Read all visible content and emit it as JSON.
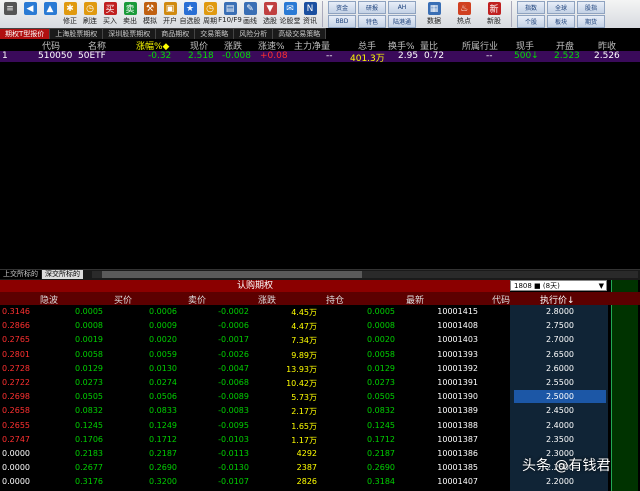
{
  "toolbar": {
    "buttons": [
      {
        "label": "",
        "icon": "menu-icon"
      },
      {
        "label": "",
        "icon": "back-arrow-icon"
      },
      {
        "label": "",
        "icon": "up-arrow-icon"
      },
      {
        "label": "修正",
        "icon": "gear-icon"
      },
      {
        "label": "刷连",
        "icon": "clock-icon"
      },
      {
        "label": "买入",
        "icon": "buy-icon"
      },
      {
        "label": "卖出",
        "icon": "sell-icon"
      },
      {
        "label": "模拟",
        "icon": "hammer-icon"
      },
      {
        "label": "开户",
        "icon": "lock-icon"
      },
      {
        "label": "自选股",
        "icon": "star-icon"
      },
      {
        "label": "周期",
        "icon": "clock-icon"
      },
      {
        "label": "F10/F9",
        "icon": "document-icon"
      },
      {
        "label": "画线",
        "icon": "pen-icon"
      },
      {
        "label": "选股",
        "icon": "filter-icon"
      },
      {
        "label": "论股堂",
        "icon": "chat-icon"
      },
      {
        "label": "资讯",
        "icon": "news-icon"
      }
    ],
    "grid1": [
      "资金",
      "研报",
      "AH",
      "BBD",
      "特色",
      "陆港通"
    ],
    "grid2_labels": [
      "数据",
      "热点",
      "新股"
    ],
    "grid3": [
      "指数",
      "全球",
      "股指",
      "个股",
      "板块",
      "期货"
    ]
  },
  "tabs": [
    "期权T型报价",
    "上海股票期权",
    "深圳股票期权",
    "商品期权",
    "交易策略",
    "风险分析",
    "高级交易策略"
  ],
  "header": [
    "代码",
    "名称",
    "涨幅%◆",
    "现价",
    "涨跌",
    "涨速%",
    "主力净量",
    "总手",
    "换手%",
    "量比",
    "所属行业",
    "现手",
    "开盘",
    "昨收"
  ],
  "quote_row": [
    "1",
    "510050",
    "50ETF",
    "-0.32",
    "2.518",
    "-0.008",
    "+0.08",
    "--",
    "401.3万",
    "2.95",
    "0.72",
    "--",
    "500↓",
    "2.523",
    "2.526"
  ],
  "sub_tabs": [
    "上交所标的",
    "深交所标的"
  ],
  "option_title": "认购期权",
  "expiry_select": "1808 ■ (8天)",
  "option_header": [
    "隐波",
    "买价",
    "卖价",
    "涨跌",
    "持仓",
    "最新",
    "代码",
    "执行价↓"
  ],
  "options": [
    [
      "0.3146",
      "0.0005",
      "0.0006",
      "-0.0002",
      "4.45万",
      "0.0005",
      "10001415",
      "2.8000"
    ],
    [
      "0.2866",
      "0.0008",
      "0.0009",
      "-0.0006",
      "4.47万",
      "0.0008",
      "10001408",
      "2.7500"
    ],
    [
      "0.2765",
      "0.0019",
      "0.0020",
      "-0.0017",
      "7.34万",
      "0.0020",
      "10001403",
      "2.7000"
    ],
    [
      "0.2801",
      "0.0058",
      "0.0059",
      "-0.0026",
      "9.89万",
      "0.0058",
      "10001393",
      "2.6500"
    ],
    [
      "0.2728",
      "0.0129",
      "0.0130",
      "-0.0047",
      "13.93万",
      "0.0129",
      "10001392",
      "2.6000"
    ],
    [
      "0.2722",
      "0.0273",
      "0.0274",
      "-0.0068",
      "10.42万",
      "0.0273",
      "10001391",
      "2.5500"
    ],
    [
      "0.2698",
      "0.0505",
      "0.0506",
      "-0.0089",
      "5.73万",
      "0.0505",
      "10001390",
      "2.5000"
    ],
    [
      "0.2658",
      "0.0832",
      "0.0833",
      "-0.0083",
      "2.17万",
      "0.0832",
      "10001389",
      "2.4500"
    ],
    [
      "0.2655",
      "0.1245",
      "0.1249",
      "-0.0095",
      "1.65万",
      "0.1245",
      "10001388",
      "2.4000"
    ],
    [
      "0.2747",
      "0.1706",
      "0.1712",
      "-0.0103",
      "1.17万",
      "0.1712",
      "10001387",
      "2.3500"
    ],
    [
      "0.0000",
      "0.2183",
      "0.2187",
      "-0.0113",
      "4292",
      "0.2187",
      "10001386",
      "2.3000"
    ],
    [
      "0.0000",
      "0.2677",
      "0.2690",
      "-0.0130",
      "2387",
      "0.2690",
      "10001385",
      "2.2500"
    ],
    [
      "0.0000",
      "0.3176",
      "0.3200",
      "-0.0107",
      "2826",
      "0.3184",
      "10001407",
      "2.2000"
    ]
  ],
  "watermark": "头条 @有钱君",
  "colors": {
    "up": "#ff3030",
    "down": "#00d000",
    "neutral": "#ffffff",
    "yellow": "#ffff00",
    "accent": "#b01010"
  }
}
